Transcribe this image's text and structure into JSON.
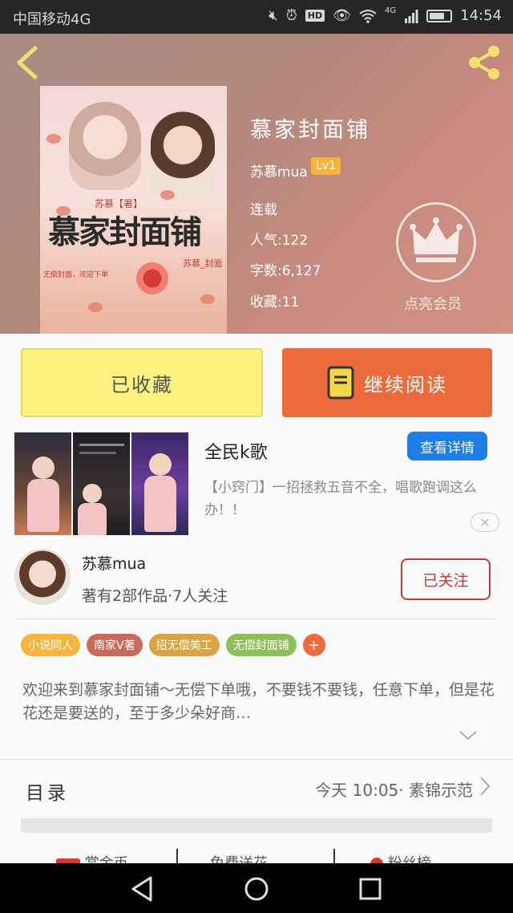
{
  "status_bar": {
    "carrier": "中国移动4G",
    "network": "4G",
    "hd": "HD",
    "time": "14:54"
  },
  "book": {
    "title": "慕家封面铺",
    "author": "苏慕mua",
    "level": "Lv1",
    "status": "连载",
    "popularity": "人气:122",
    "word_count": "字数:6,127",
    "favorites": "收藏:11",
    "vip_label": "点亮会员",
    "cover": {
      "title_text": "慕家封面铺",
      "author_tag": "苏慕【著】",
      "author_sign": "苏慕_封面",
      "note": "无偿封面，欢迎下单"
    }
  },
  "actions": {
    "collect_label": "已收藏",
    "read_label": "继续阅读"
  },
  "ad": {
    "title": "全民k歌",
    "detail_label": "查看详情",
    "description": "【小窍门】一招拯救五音不全，唱歌跑调这么办！！",
    "close_symbol": "✕"
  },
  "author": {
    "name": "苏慕mua",
    "stats": "著有2部作品·7人关注",
    "follow_label": "已关注"
  },
  "tags": [
    {
      "label": "小说同人",
      "color": "#f5b43c"
    },
    {
      "label": "南家V著",
      "color": "#c96b5a"
    },
    {
      "label": "招无偿美工",
      "color": "#d9a441"
    },
    {
      "label": "无偿封面铺",
      "color": "#8fbf5a"
    }
  ],
  "tag_more": "+",
  "intro": {
    "text": "欢迎来到慕家封面铺～无偿下单哦，不要钱不要钱，任意下单，但是花花还是要送的，至于多少朵好商…"
  },
  "catalog": {
    "label": "目录",
    "latest": "今天 10:05· 素锦示范"
  },
  "bottom_strip": [
    "赏金币",
    "免费送花",
    "粉丝榜"
  ]
}
